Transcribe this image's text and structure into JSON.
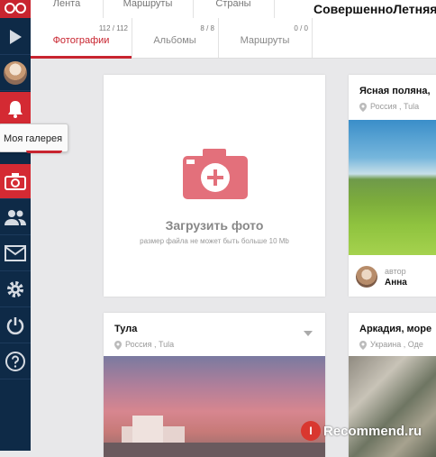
{
  "sidebar": {
    "tooltip": "Моя галерея",
    "accent": "#d42a33",
    "bg": "#0e2a47"
  },
  "topnav": {
    "items": [
      "Лента",
      "Маршруты",
      "Страны"
    ],
    "title": "СовершенноЛетняя"
  },
  "tabs": [
    {
      "label": "Фотографии",
      "count": "112 / 112",
      "active": true
    },
    {
      "label": "Альбомы",
      "count": "8 / 8",
      "active": false
    },
    {
      "label": "Маршруты",
      "count": "0 / 0",
      "active": false
    }
  ],
  "upload": {
    "title": "Загрузить фото",
    "hint": "размер файла не может быть больше 10 Mb"
  },
  "cards": [
    {
      "title": "Ясная поляна,",
      "location": "Россия ,  Tula",
      "author_label": "автор",
      "author_name": "Анна"
    },
    {
      "title": "Тула",
      "location": "Россия ,  Tula"
    },
    {
      "title": "Аркадия, море",
      "location": "Украина ,  Оде"
    }
  ],
  "watermark": {
    "badge": "I",
    "text": "Recommend.ru"
  }
}
